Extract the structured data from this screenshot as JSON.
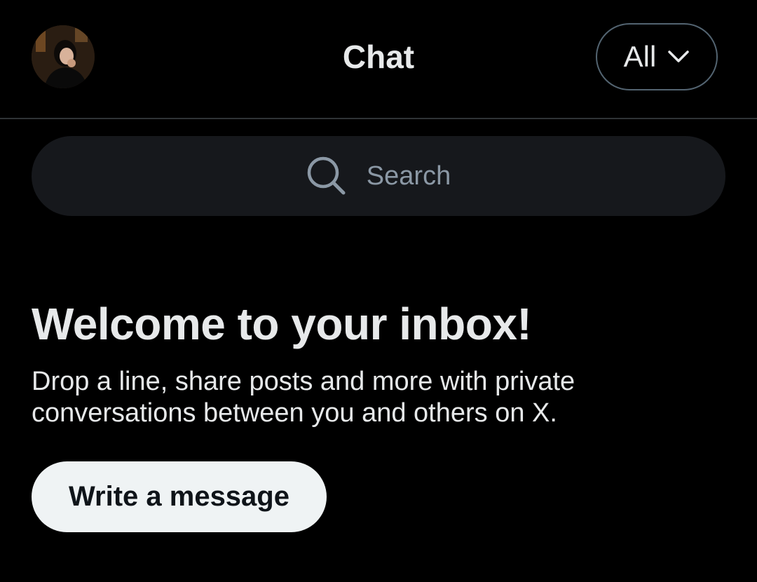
{
  "header": {
    "title": "Chat",
    "filter_label": "All",
    "filter_icon": "chevron-down-icon",
    "avatar_icon": "user-avatar"
  },
  "search": {
    "placeholder": "Search",
    "icon": "search-icon"
  },
  "empty_state": {
    "title": "Welcome to your inbox!",
    "body": "Drop a line, share posts and more with private conversations between you and others on X.",
    "cta_label": "Write a message"
  },
  "colors": {
    "background": "#000000",
    "text_primary": "#e7e9ea",
    "text_secondary": "#8b98a5",
    "search_background": "#16181c",
    "divider": "#2f3336",
    "button_background": "#eff3f4",
    "button_text": "#0f1419"
  }
}
